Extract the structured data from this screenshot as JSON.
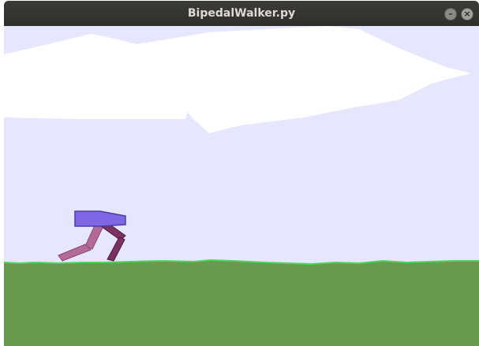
{
  "window": {
    "title": "BipedalWalker.py",
    "minimize_glyph": "–",
    "close_glyph": "×"
  },
  "scene": {
    "environment": "BipedalWalker",
    "colors": {
      "sky": "#e6e6fe",
      "cloud": "#ffffff",
      "ground": "#669a4c",
      "grass_edge": "#4fd35a",
      "hull": "#7f66e5",
      "hull_outline": "#4c3ea0",
      "leg_far": "#b46a96",
      "leg_near": "#7a3262"
    }
  }
}
